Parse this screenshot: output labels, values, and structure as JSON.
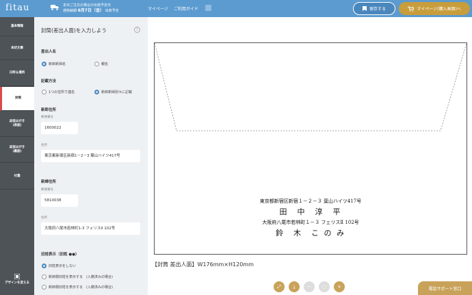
{
  "header": {
    "logo": "fitau",
    "ship_line1": "本日ご注文の場合の出荷予定日",
    "ship_line2_prefix": "通常納期",
    "ship_date": "6月7日（金）",
    "ship_line2_suffix": "出荷予定",
    "nav_mypage": "マイページ",
    "nav_guide": "ご利用ガイド",
    "save_label": "保存する",
    "mypage_button_label": "マイページ(購入画面)へ"
  },
  "sidebar": {
    "items": [
      {
        "label": "基本情報"
      },
      {
        "label": "本状文章"
      },
      {
        "label": "日時＆場所"
      },
      {
        "label": "封筒"
      },
      {
        "label": "返信はがき\n(表面)"
      },
      {
        "label": "返信はがき\n(裏面)"
      },
      {
        "label": "付箋"
      }
    ],
    "design_label": "デザインを変える"
  },
  "form": {
    "title": "封筒(差出人面)を入力しよう",
    "help": "?",
    "sender_name_label": "差出人名",
    "sender_options": [
      "新郎新婦名",
      "親名"
    ],
    "method_label": "記載方法",
    "method_options": [
      "1つの住所で連名",
      "新郎新婦別々に記載"
    ],
    "groom_section": "新郎住所",
    "groom_postal_label": "郵便番号",
    "groom_postal_value": "1600022",
    "groom_address_label": "住所",
    "groom_address_value": "東京都新宿区新宿1－2－3 葉山ハイツ417号",
    "bride_section": "新婦住所",
    "bride_postal_label": "郵便番号",
    "bride_postal_value": "5810038",
    "bride_address_label": "住所",
    "bride_address_value": "大阪府八尾市若林町1-3 フェリスII 102号",
    "old_name_label": "旧姓表示（旧姓 ●●）",
    "old_name_options": [
      "旧姓表示をしない",
      "新郎側旧姓を表示する　(入籍済みの場合)",
      "新郎側旧姓を表示する　(入籍済みの場合)"
    ]
  },
  "preview": {
    "addr1": "東京都新宿区新宿１－２－３ 葉山ハイツ417号",
    "name1": "田　中　淳　平",
    "addr2": "大阪府八尾市若林町１－３ フェリスⅡ 102号",
    "name2": "鈴　木　こ の み",
    "size_label": "【封筒 差出人面】W176mm×H120mm",
    "support_label": "電話サポート窓口"
  }
}
